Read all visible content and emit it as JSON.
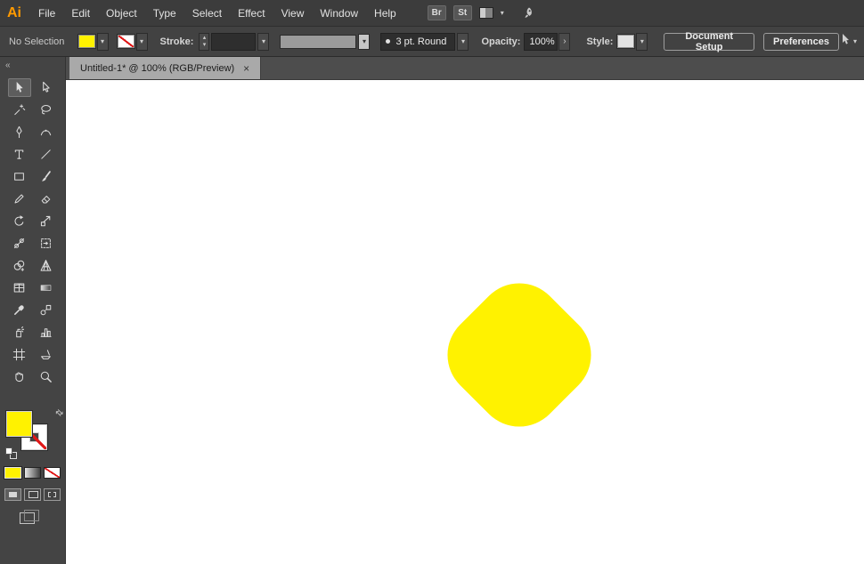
{
  "app": {
    "logo": "Ai"
  },
  "menubar": {
    "items": [
      "File",
      "Edit",
      "Object",
      "Type",
      "Select",
      "Effect",
      "View",
      "Window",
      "Help"
    ],
    "bridge_label": "Br",
    "stock_label": "St"
  },
  "control_bar": {
    "selection_status": "No Selection",
    "stroke_label": "Stroke:",
    "brush_name": "3 pt. Round",
    "opacity_label": "Opacity:",
    "opacity_value": "100%",
    "style_label": "Style:",
    "document_setup_label": "Document Setup",
    "preferences_label": "Preferences"
  },
  "tab_bar": {
    "active_tab": "Untitled-1* @ 100% (RGB/Preview)"
  },
  "toolbar": {
    "tools": [
      "Selection",
      "Direct Selection",
      "Magic Wand",
      "Lasso",
      "Pen",
      "Curvature",
      "Type",
      "Line Segment",
      "Rectangle",
      "Paintbrush",
      "Shaper",
      "Eraser",
      "Rotate",
      "Scale",
      "Width",
      "Free Transform",
      "Shape Builder",
      "Perspective Grid",
      "Mesh",
      "Gradient",
      "Eyedropper",
      "Blend",
      "Symbol Sprayer",
      "Column Graph",
      "Artboard",
      "Slice",
      "Hand",
      "Zoom"
    ],
    "active_tool": "Selection"
  },
  "swatches": {
    "fill_color": "#FFF200",
    "stroke": "none"
  },
  "canvas": {
    "artboard_bg": "#FFFFFF",
    "shape": {
      "type": "rounded-square rotated 45deg",
      "fill": "#FFF200"
    }
  },
  "glyphs": {
    "caret_down": "▾",
    "caret_up": "▴",
    "chevron_right": "›",
    "collapse_chevrons": "«",
    "swap_arrows": "⇄",
    "close": "×",
    "brush_dot": ""
  }
}
